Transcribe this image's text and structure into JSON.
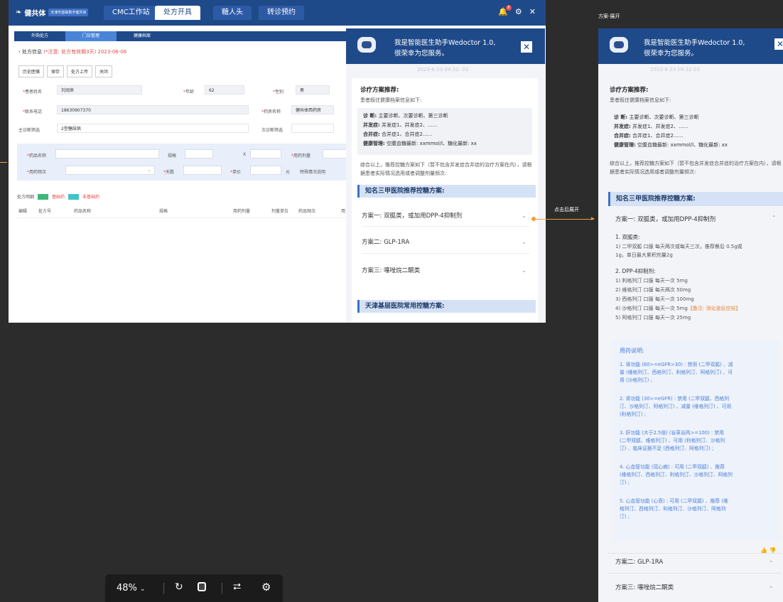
{
  "app": {
    "logo_text": "健共体",
    "logo_sub": "天津市基础数字健共体",
    "top_tabs": [
      "CMC工作站",
      "处方开具",
      "糖人头",
      "转诊预约"
    ],
    "notification_count": "8",
    "sub_tabs": [
      "外购处方",
      "门诊管理",
      "健康档案"
    ],
    "crumb_prefix": "处方信息",
    "crumb_warning": "(*注意: 处方有效期3天)",
    "crumb_date": "2023-06-06",
    "buttons": [
      "历史医嘱",
      "保存",
      "处方上传",
      "关闭"
    ],
    "patient": {
      "name_label": "患者姓名",
      "name": "刘润来",
      "age_label": "年龄",
      "age": "62",
      "sex_label": "性别",
      "sex": "男",
      "phone_label": "联系电话",
      "phone": "18630907370",
      "pharmacy_label": "药房名称",
      "pharmacy": "健共体西药房",
      "main_dx_label": "主诊断筛选",
      "main_dx": "2型糖尿病",
      "sec_dx_label": "次诊断筛选"
    },
    "rx": {
      "drug_label": "药品名称",
      "spec_label": "规格",
      "x": "X",
      "dose_label": "用药剂量",
      "freq_label": "用药频次",
      "days_label": "天数",
      "price_label": "单价",
      "unit": "元",
      "special_label": "特殊情况说明"
    },
    "legend": {
      "title": "处方明细",
      "basic": "基础药",
      "nonbasic": "非基础药"
    },
    "table_cols": [
      "编辑",
      "处方号",
      "药品名称",
      "规格",
      "用药剂量",
      "剂量单位",
      "药品频次",
      "用"
    ]
  },
  "chat": {
    "greeting1": "我是智能医生助手Wedoctor 1.0,",
    "greeting2": "很荣幸为您服务。",
    "time": "2023-6-23 09:32: 03",
    "title": "诊疗方案推荐:",
    "intro": "患者既往健康档案信息如下:",
    "dx_label": "诊 断:",
    "dx": "主要诊断、次要诊断、第三诊断",
    "comp_label": "并发症:",
    "comp": "并发症1、并发症2、......",
    "merge_label": "合并症:",
    "merge": "合并症1、合并症2......",
    "health_label": "健康管理:",
    "health": "空腹血糖最新: xxmmol/l、糖化最新: xx",
    "summary": "综合以上，推荐控糖方案如下（暂不包含并发症合并症的治疗方案在内），请根据患者实际情况选用或者调整剂量频次:",
    "section1": "知名三甲医院推荐控糖方案:",
    "plans": [
      "方案一: 双胍类，或加用DPP-4抑制剂",
      "方案二: GLP-1RA",
      "方案三: 噻唑烷二酮类"
    ],
    "section2": "天津基层医院常用控糖方案:"
  },
  "expanded": {
    "label": "方案-展开",
    "time": "2023-6-23 09:32:03",
    "arrow_label": "点击后展开",
    "g1": "1. 双胍类:",
    "g1_items": [
      "1) 二甲双胍 口服 每天两次或每天三次，推荐餐后 0.5g或",
      "1g，单日最大累积剂量2g"
    ],
    "g2": "2. DPP-4抑制剂:",
    "g2_items": [
      "1) 利格列汀 口服 每天一次 5mg",
      "2) 维格列汀 口服 每天两次 50mg",
      "3) 西格列汀 口服 每天一次 100mg",
      "4) 沙格列汀 口服 每天一次 5mg",
      "5) 阿格列汀 口服 每天一次 25mg"
    ],
    "g2_note": "【备注: 消化道反应轻】",
    "usage_title": "用药说明:",
    "usage": [
      [
        "1. 肾功能 (60>=eGFR>30) : 禁用 (二甲双胍) 、减",
        "量 (维格列汀、西格列汀、利格列汀、阿格列汀) 、可",
        "用 (沙格列汀) ;"
      ],
      [
        "2. 肾功能 (30>=eGFR) : 禁用 (二甲双胍、西格列",
        "汀、沙格列汀、阿格列汀) 、减量 (维格列汀) 、可用",
        "(利格列汀) ;"
      ],
      [
        "3. 肝功能 (大于2.5倍) (谷草谷丙>=100) : 禁用",
        "(二甲双胍、维格列汀) 、可用 (利格列汀、沙格列",
        "汀) 、临床证据不足 (西格列汀、阿格列汀) ;"
      ],
      [
        "4. 心血管功能 (冠心病) : 可用 (二甲双胍) 、推荐",
        "(维格列汀、西格列汀、利格列汀、沙格列汀、阿格列",
        "汀) ;"
      ],
      [
        "5. 心血管功能 (心衰) : 可用 (二甲双胍) 、推荐 (维",
        "格列汀、西格列汀、利格列汀、沙格列汀、阿格列",
        "汀) ;"
      ]
    ]
  },
  "zoom": {
    "level": "48%"
  }
}
